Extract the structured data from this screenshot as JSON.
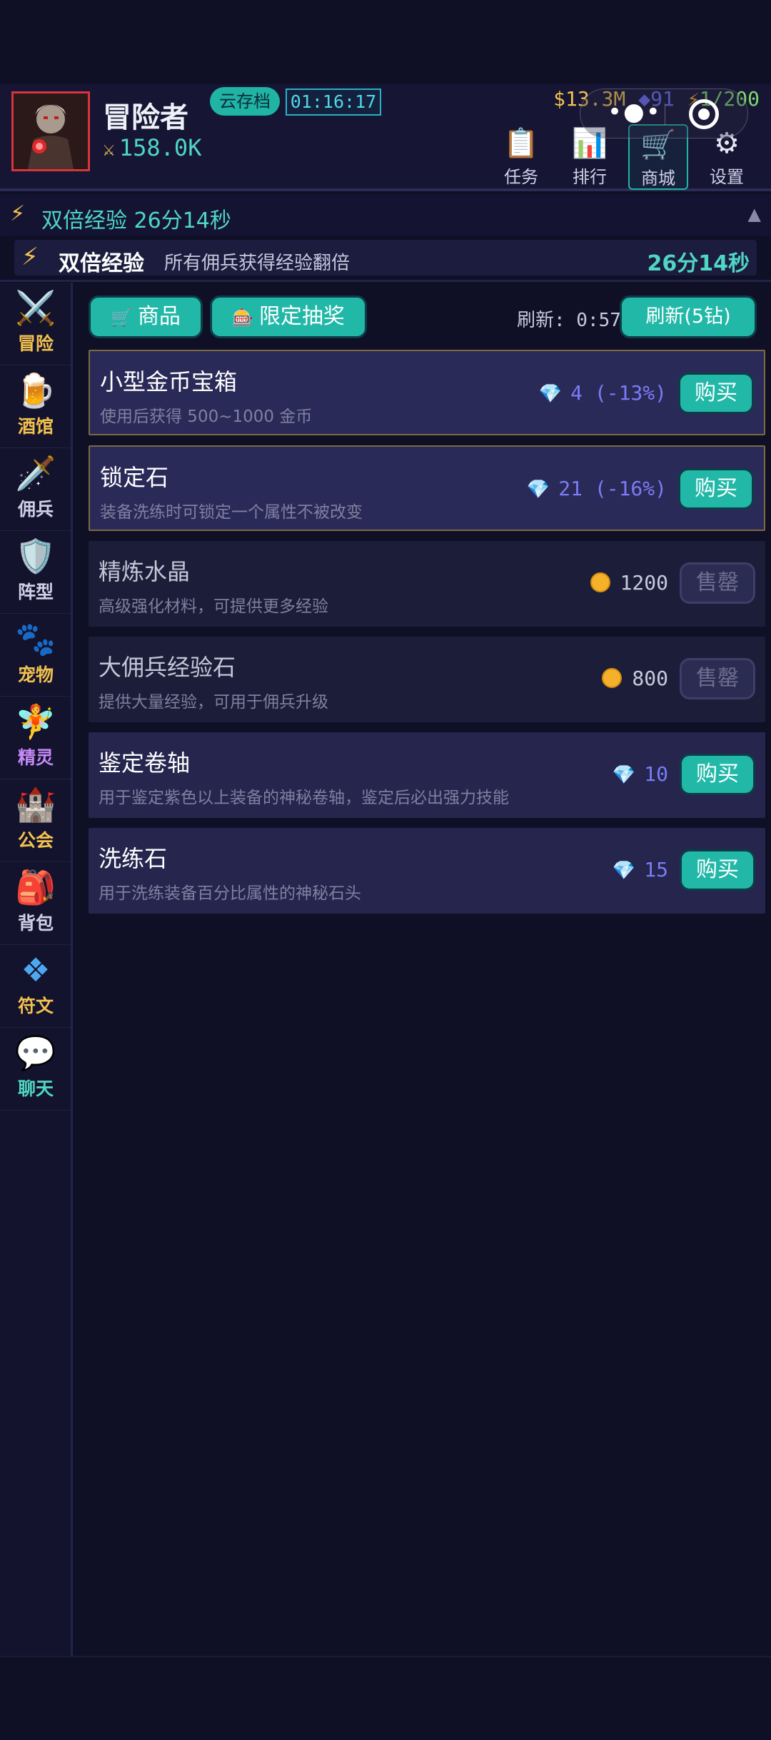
{
  "player": {
    "name": "冒险者",
    "cloud_save_label": "云存档",
    "timer": "01:16:17",
    "power": "158.0K"
  },
  "currencies": {
    "gold": "$13.3M",
    "gems": "◆91",
    "energy": "1/200"
  },
  "top_nav": [
    {
      "label": "任务",
      "icon": "clipboard-icon"
    },
    {
      "label": "排行",
      "icon": "bar-chart-icon"
    },
    {
      "label": "商城",
      "icon": "cart-icon"
    },
    {
      "label": "设置",
      "icon": "gear-icon"
    }
  ],
  "event": {
    "bar_title": "双倍经验 26分14秒",
    "panel_title": "双倍经验",
    "panel_desc": "所有佣兵获得经验翻倍",
    "panel_time": "26分14秒"
  },
  "sidebar": {
    "items": [
      {
        "label": "冒险",
        "icon": "crossed-swords-icon",
        "color": "#f2c14e"
      },
      {
        "label": "酒馆",
        "icon": "beer-mug-icon",
        "color": "#f2c14e"
      },
      {
        "label": "佣兵",
        "icon": "dagger-icon",
        "color": "#cfd0e6"
      },
      {
        "label": "阵型",
        "icon": "shield-icon",
        "color": "#cfd0e6"
      },
      {
        "label": "宠物",
        "icon": "paw-icon",
        "color": "#f2c14e"
      },
      {
        "label": "精灵",
        "icon": "fairy-icon",
        "color": "#c58af5"
      },
      {
        "label": "公会",
        "icon": "castle-icon",
        "color": "#f2c14e"
      },
      {
        "label": "背包",
        "icon": "backpack-icon",
        "color": "#cfd0e6"
      },
      {
        "label": "符文",
        "icon": "rune-icon",
        "color": "#f2c14e"
      },
      {
        "label": "聊天",
        "icon": "chat-bubble-icon",
        "color": "#4fd6c4"
      }
    ]
  },
  "shop": {
    "tabs": [
      {
        "label": "商品"
      },
      {
        "label": "限定抽奖"
      }
    ],
    "refresh_timer": "刷新: 0:57",
    "refresh_button": "刷新(5钻)",
    "items": [
      {
        "name": "小型金币宝箱",
        "desc": "使用后获得 500~1000 金币",
        "currency": "gem",
        "price": "4 (-13%)",
        "action": "购买",
        "style": "hl"
      },
      {
        "name": "锁定石",
        "desc": "装备洗练时可锁定一个属性不被改变",
        "currency": "gem",
        "price": "21 (-16%)",
        "action": "购买",
        "style": "hl"
      },
      {
        "name": "精炼水晶",
        "desc": "高级强化材料，可提供更多经验",
        "currency": "coin",
        "price": "1200",
        "action": "售罄",
        "style": "dim"
      },
      {
        "name": "大佣兵经验石",
        "desc": "提供大量经验，可用于佣兵升级",
        "currency": "coin",
        "price": "800",
        "action": "售罄",
        "style": "dim"
      },
      {
        "name": "鉴定卷轴",
        "desc": "用于鉴定紫色以上装备的神秘卷轴，鉴定后必出强力技能",
        "currency": "gem",
        "price": "10",
        "action": "购买",
        "style": "normal"
      },
      {
        "name": "洗练石",
        "desc": "用于洗练装备百分比属性的神秘石头",
        "currency": "gem",
        "price": "15",
        "action": "购买",
        "style": "normal"
      }
    ]
  }
}
